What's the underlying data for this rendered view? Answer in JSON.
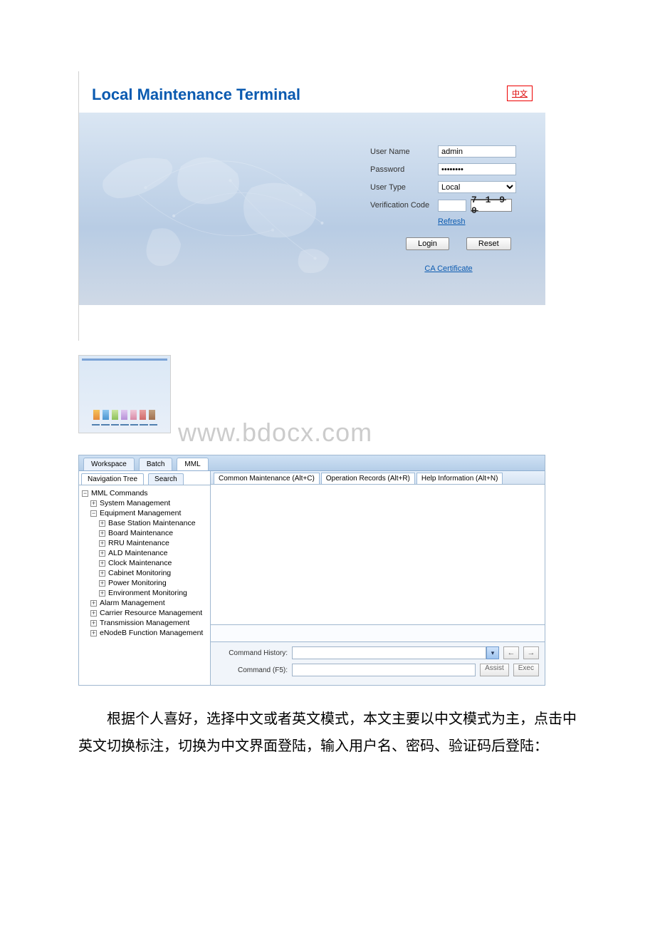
{
  "login": {
    "title": "Local Maintenance Terminal",
    "lang_link": "中文",
    "fields": {
      "username_label": "User Name",
      "username_value": "admin",
      "password_label": "Password",
      "password_value": "••••••••",
      "usertype_label": "User Type",
      "usertype_value": "Local",
      "vcode_label": "Verification Code",
      "vcode_value": "",
      "vcode_image": "7 1 9 0"
    },
    "refresh": "Refresh",
    "login_btn": "Login",
    "reset_btn": "Reset",
    "ca_link": "CA Certificate"
  },
  "watermark": "www.bdocx.com",
  "workbench": {
    "tabs": [
      "Workspace",
      "Batch",
      "MML"
    ],
    "active_tab": 2,
    "side_tabs": [
      "Navigation Tree",
      "Search"
    ],
    "side_active": 0,
    "tree": {
      "root": "MML Commands",
      "root_sym": "−",
      "items": [
        {
          "label": "System Management",
          "sym": "+",
          "level": 1
        },
        {
          "label": "Equipment Management",
          "sym": "−",
          "level": 1
        },
        {
          "label": "Base Station Maintenance",
          "sym": "+",
          "level": 2
        },
        {
          "label": "Board Maintenance",
          "sym": "+",
          "level": 2
        },
        {
          "label": "RRU Maintenance",
          "sym": "+",
          "level": 2
        },
        {
          "label": "ALD Maintenance",
          "sym": "+",
          "level": 2
        },
        {
          "label": "Clock Maintenance",
          "sym": "+",
          "level": 2
        },
        {
          "label": "Cabinet Monitoring",
          "sym": "+",
          "level": 2
        },
        {
          "label": "Power Monitoring",
          "sym": "+",
          "level": 2
        },
        {
          "label": "Environment Monitoring",
          "sym": "+",
          "level": 2
        },
        {
          "label": "Alarm Management",
          "sym": "+",
          "level": 1
        },
        {
          "label": "Carrier Resource Management",
          "sym": "+",
          "level": 1
        },
        {
          "label": "Transmission Management",
          "sym": "+",
          "level": 1
        },
        {
          "label": "eNodeB Function Management",
          "sym": "+",
          "level": 1
        }
      ]
    },
    "main_tabs": [
      "Common Maintenance (Alt+C)",
      "Operation Records (Alt+R)",
      "Help Information (Alt+N)"
    ],
    "cmd": {
      "history_label": "Command History:",
      "history_value": "",
      "cmd_label": "Command (F5):",
      "cmd_value": "",
      "prev": "←",
      "next": "→",
      "assist": "Assist",
      "exec": "Exec"
    }
  },
  "body_text": "根据个人喜好，选择中文或者英文模式，本文主要以中文模式为主，点击中英文切换标注，切换为中文界面登陆，输入用户名、密码、验证码后登陆："
}
